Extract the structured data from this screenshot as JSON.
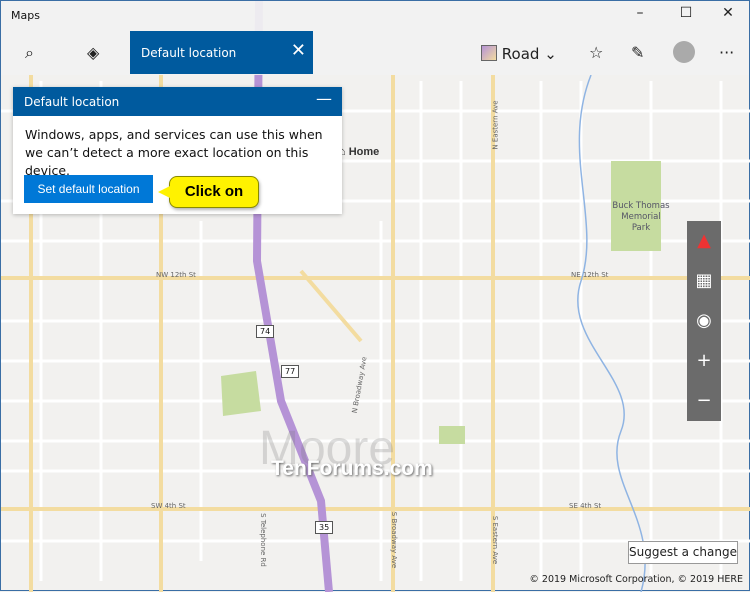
{
  "window": {
    "title": "Maps",
    "minimize": "–",
    "maximize": "☐",
    "close": "✕"
  },
  "toolbar": {
    "search_tab": "Default location",
    "close_tab": "✕",
    "map_style": "Road",
    "more": "···"
  },
  "panel": {
    "title": "Default location",
    "minimize": "—",
    "body": "Windows, apps, and services can use this when we can’t detect a more exact location on this device.",
    "button": "Set default location"
  },
  "callout": "Click on",
  "map": {
    "home": "Home",
    "park": "Buck Thomas Memorial Park",
    "town": "Moore",
    "streets": [
      "NW 12th St",
      "NE 12th St",
      "SW 4th St",
      "SE 4th St",
      "N Eastern Ave",
      "S Eastern Ave",
      "N Broadway Ave",
      "S Broadway Ave",
      "S Telephone Rd"
    ],
    "shields": [
      "74",
      "77",
      "35"
    ],
    "colors": {
      "highway": "#b593d6",
      "arterial": "#f3dca0",
      "park": "#c6dca0",
      "water": "#8fb4e3"
    }
  },
  "watermark": "TenForums.com",
  "suggest": "Suggest a change",
  "copyright": "© 2019 Microsoft Corporation, © 2019 HERE"
}
